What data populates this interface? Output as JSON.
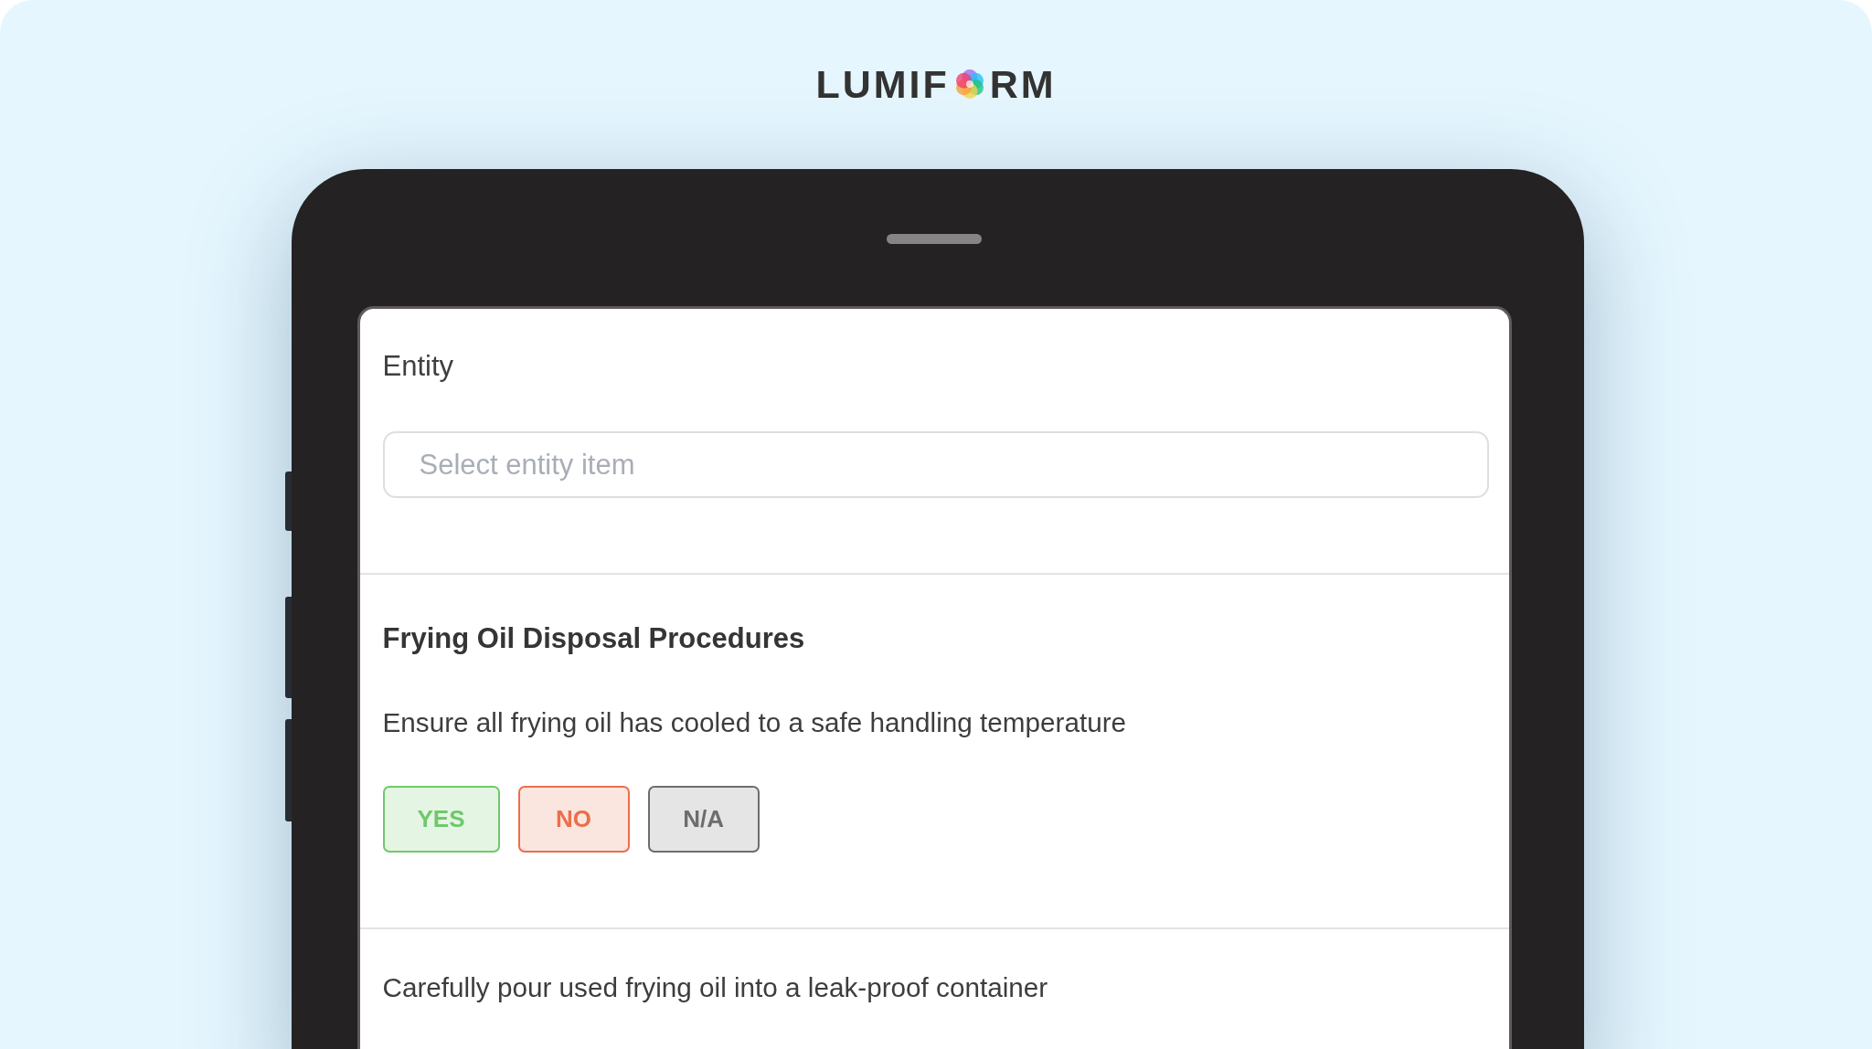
{
  "logo": {
    "lead": "LUMIF",
    "tail": "RM"
  },
  "entity": {
    "label": "Entity",
    "placeholder": "Select entity item"
  },
  "section": {
    "title": "Frying Oil Disposal Procedures",
    "questions": [
      {
        "text": "Ensure all frying oil has cooled to a safe handling temperature",
        "options": [
          {
            "label": "YES",
            "color": "#6fc86b",
            "selected": false
          },
          {
            "label": "NO",
            "color": "#ea6f4b",
            "selected": false
          },
          {
            "label": "N/A",
            "color": "#6d6d6d",
            "selected": false
          }
        ]
      },
      {
        "text": "Carefully pour used frying oil into a leak-proof container"
      }
    ]
  }
}
